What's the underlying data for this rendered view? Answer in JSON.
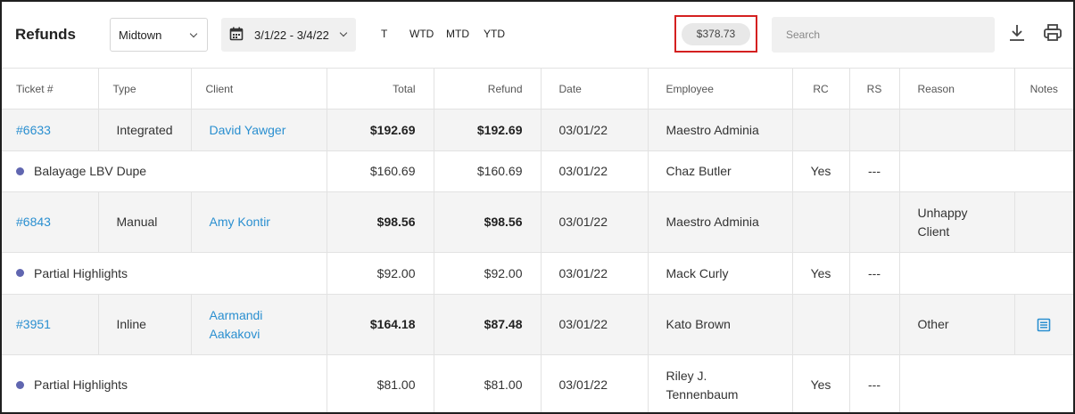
{
  "header": {
    "title": "Refunds",
    "location": "Midtown",
    "date_range": "3/1/22 - 3/4/22",
    "periods": [
      "T",
      "WTD",
      "MTD",
      "YTD"
    ],
    "total": "$378.73",
    "search_placeholder": "Search"
  },
  "table": {
    "columns": [
      "Ticket #",
      "Type",
      "Client",
      "Total",
      "Refund",
      "Date",
      "Employee",
      "RC",
      "RS",
      "Reason",
      "Notes"
    ],
    "rows": [
      {
        "ticket": "#6633",
        "type": "Integrated",
        "client": "David Yawger",
        "total": "$192.69",
        "refund": "$192.69",
        "date": "03/01/22",
        "employee": "Maestro Adminia",
        "rc": "",
        "rs": "",
        "reason": "",
        "has_note": false
      },
      {
        "service": "Balayage LBV Dupe",
        "total": "$160.69",
        "refund": "$160.69",
        "date": "03/01/22",
        "employee": "Chaz Butler",
        "rc": "Yes",
        "rs": "---"
      },
      {
        "ticket": "#6843",
        "type": "Manual",
        "client": "Amy Kontir",
        "total": "$98.56",
        "refund": "$98.56",
        "date": "03/01/22",
        "employee": "Maestro Adminia",
        "rc": "",
        "rs": "",
        "reason": "Unhappy Client",
        "has_note": false
      },
      {
        "service": "Partial Highlights",
        "total": "$92.00",
        "refund": "$92.00",
        "date": "03/01/22",
        "employee": "Mack Curly",
        "rc": "Yes",
        "rs": "---"
      },
      {
        "ticket": "#3951",
        "type": "Inline",
        "client": "Aarmandi Aakakovi",
        "total": "$164.18",
        "refund": "$87.48",
        "date": "03/01/22",
        "employee": "Kato Brown",
        "rc": "",
        "rs": "",
        "reason": "Other",
        "has_note": true
      },
      {
        "service": "Partial Highlights",
        "total": "$81.00",
        "refund": "$81.00",
        "date": "03/01/22",
        "employee": "Riley J. Tennenbaum",
        "rc": "Yes",
        "rs": "---"
      }
    ]
  },
  "colors": {
    "link": "#2a8fd0",
    "service_dot": "#6066b0",
    "highlight_border": "#d42020"
  }
}
